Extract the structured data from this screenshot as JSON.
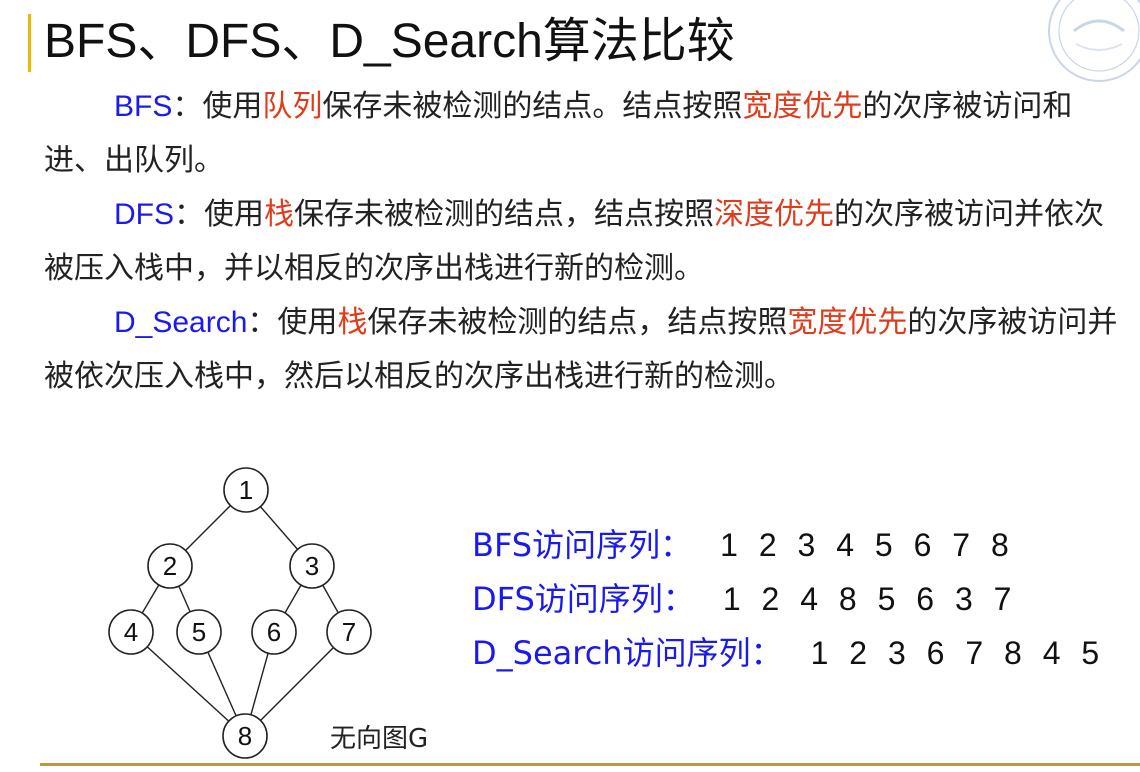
{
  "title": "BFS、DFS、D_Search算法比较",
  "paragraphs": [
    {
      "keyword": "BFS",
      "segments": [
        {
          "text": "：使用",
          "hl": false
        },
        {
          "text": "队列",
          "hl": true
        },
        {
          "text": "保存未被检测的结点。结点按照",
          "hl": false
        },
        {
          "text": "宽度优先",
          "hl": true
        },
        {
          "text": "的次序被访问和进、出队列。",
          "hl": false
        }
      ]
    },
    {
      "keyword": "DFS",
      "segments": [
        {
          "text": "：使用",
          "hl": false
        },
        {
          "text": "栈",
          "hl": true
        },
        {
          "text": "保存未被检测的结点，结点按照",
          "hl": false
        },
        {
          "text": "深度优先",
          "hl": true
        },
        {
          "text": "的次序被访问并依次被压入栈中，并以相反的次序出栈进行新的检测。",
          "hl": false
        }
      ]
    },
    {
      "keyword": "D_Search",
      "segments": [
        {
          "text": "：使用",
          "hl": false
        },
        {
          "text": "栈",
          "hl": true
        },
        {
          "text": "保存未被检测的结点，结点按照",
          "hl": false
        },
        {
          "text": "宽度优先",
          "hl": true
        },
        {
          "text": "的次序被访问并被依次压入栈中，然后以相反的次序出栈进行新的检测。",
          "hl": false
        }
      ]
    }
  ],
  "graph": {
    "caption": "无向图G",
    "nodes": [
      "1",
      "2",
      "3",
      "4",
      "5",
      "6",
      "7",
      "8"
    ],
    "edges": [
      [
        "1",
        "2"
      ],
      [
        "1",
        "3"
      ],
      [
        "2",
        "4"
      ],
      [
        "2",
        "5"
      ],
      [
        "3",
        "6"
      ],
      [
        "3",
        "7"
      ],
      [
        "4",
        "8"
      ],
      [
        "5",
        "8"
      ],
      [
        "6",
        "8"
      ],
      [
        "7",
        "8"
      ]
    ]
  },
  "sequences": [
    {
      "label": "BFS访问序列：",
      "value": "1 2 3 4 5 6 7 8"
    },
    {
      "label": "DFS访问序列：",
      "value": "1 2 4 8 5 6 3 7"
    },
    {
      "label": "D_Search访问序列：",
      "value": "1 2 3 6 7 8 4 5"
    }
  ],
  "colors": {
    "accent": "#f2b800",
    "keyword": "#1a1aee",
    "highlight": "#e03c1c",
    "rule": "#b89a4a"
  }
}
